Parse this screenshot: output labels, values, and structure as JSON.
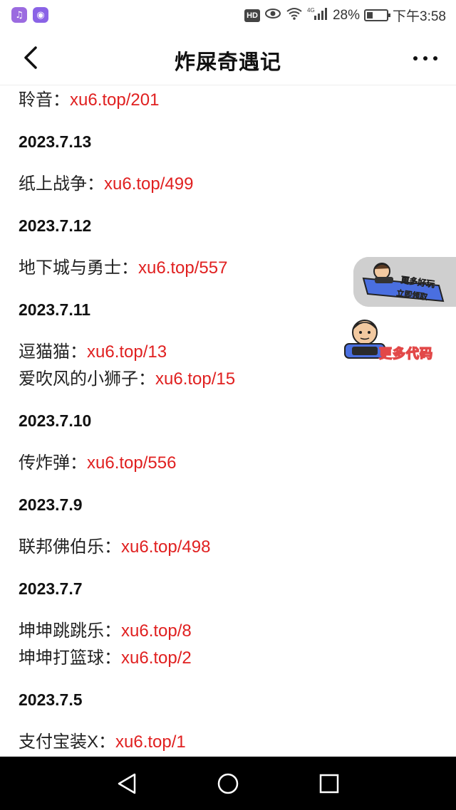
{
  "status_bar": {
    "hd": "HD",
    "network": "4G",
    "battery": "28%",
    "time": "下午3:58"
  },
  "header": {
    "title": "炸屎奇遇记"
  },
  "entries": [
    {
      "type": "item",
      "name": "聆音：",
      "link": "xu6.top/201"
    },
    {
      "type": "date",
      "text": "2023.7.13"
    },
    {
      "type": "item",
      "name": "纸上战争：",
      "link": "xu6.top/499"
    },
    {
      "type": "date",
      "text": "2023.7.12"
    },
    {
      "type": "item",
      "name": "地下城与勇士：",
      "link": "xu6.top/557"
    },
    {
      "type": "date",
      "text": "2023.7.11"
    },
    {
      "type": "item",
      "name": "逗猫猫：",
      "link": "xu6.top/13"
    },
    {
      "type": "item",
      "name": "爱吹风的小狮子：",
      "link": "xu6.top/15"
    },
    {
      "type": "date",
      "text": "2023.7.10"
    },
    {
      "type": "item",
      "name": "传炸弹：",
      "link": "xu6.top/556"
    },
    {
      "type": "date",
      "text": "2023.7.9"
    },
    {
      "type": "item",
      "name": "联邦佛伯乐：",
      "link": "xu6.top/498"
    },
    {
      "type": "date",
      "text": "2023.7.7"
    },
    {
      "type": "item",
      "name": "坤坤跳跳乐：",
      "link": "xu6.top/8"
    },
    {
      "type": "item",
      "name": "坤坤打篮球：",
      "link": "xu6.top/2"
    },
    {
      "type": "date",
      "text": "2023.7.5"
    },
    {
      "type": "item",
      "name": "支付宝装X：",
      "link": "xu6.top/1"
    }
  ],
  "floating": {
    "pill_text": "更多好玩",
    "pill_subtext": "立即领取",
    "badge_text": "更多代码"
  },
  "colors": {
    "link": "#e02020",
    "text": "#222222",
    "nav_bg": "#000000"
  }
}
